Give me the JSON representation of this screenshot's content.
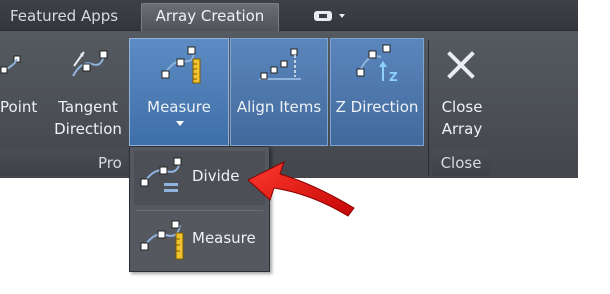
{
  "tabs": {
    "featured": "Featured Apps",
    "active": "Array Creation"
  },
  "ribbon": {
    "point": "Point",
    "tangent_line1": "Tangent",
    "tangent_line2": "Direction",
    "measure": "Measure",
    "align_items": "Align Items",
    "z_direction": "Z Direction",
    "close_line1": "Close",
    "close_line2": "Array",
    "panel_pro": "Pro",
    "panel_close": "Close"
  },
  "dropdown": {
    "divide": "Divide",
    "measure": "Measure"
  },
  "colors": {
    "accent": "#4a7bb7",
    "ruler": "#f2c230",
    "arrow": "#e01010"
  }
}
